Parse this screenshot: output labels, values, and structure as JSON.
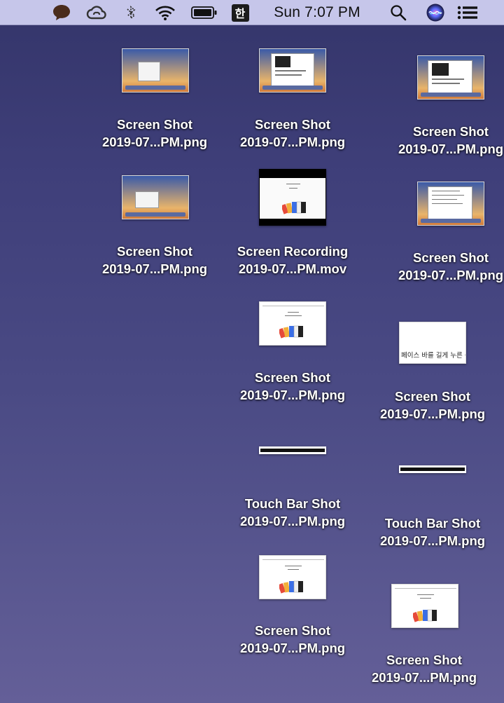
{
  "menubar": {
    "clock": "Sun 7:07 PM",
    "input_source": "한",
    "icons": [
      "chat-bubble-icon",
      "creative-cloud-icon",
      "bluetooth-icon",
      "wifi-icon",
      "battery-icon",
      "input-source-icon",
      "spotlight-search-icon",
      "siri-icon",
      "notification-center-icon"
    ]
  },
  "files": [
    {
      "line1": "Screen Shot",
      "line2": "2019-07...PM.png"
    },
    {
      "line1": "Screen Shot",
      "line2": "2019-07...PM.png"
    },
    {
      "line1": "Screen Shot",
      "line2": "2019-07...PM.png"
    },
    {
      "line1": "Screen Shot",
      "line2": "2019-07...PM.png"
    },
    {
      "line1": "Screen Recording",
      "line2": "2019-07...PM.mov"
    },
    {
      "line1": "Screen Shot",
      "line2": "2019-07...PM.png"
    },
    {
      "line1": "Screen Shot",
      "line2": "2019-07...PM.png"
    },
    {
      "line1": "Screen Shot",
      "line2": "2019-07...PM.png",
      "thumb_text": "페이스 바를 길게 누른 상태"
    },
    {
      "line1": "Touch Bar Shot",
      "line2": "2019-07...PM.png"
    },
    {
      "line1": "Touch Bar Shot",
      "line2": "2019-07...PM.png"
    },
    {
      "line1": "Screen Shot",
      "line2": "2019-07...PM.png"
    },
    {
      "line1": "Screen Shot",
      "line2": "2019-07...PM.png"
    }
  ]
}
